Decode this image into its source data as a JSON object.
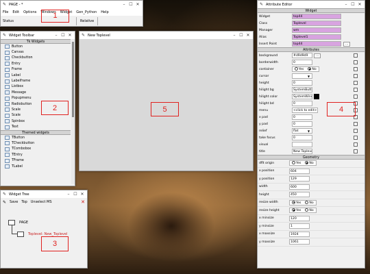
{
  "page_window": {
    "title": "PAGE - *",
    "menu": [
      "File",
      "Edit",
      "Options",
      "Windows",
      "Widget",
      "Gen_Python",
      "Help"
    ],
    "status_label": "Status",
    "relative_label": "Relative",
    "marker": "1"
  },
  "toolbar_window": {
    "title": "Widget Toolbar",
    "tk_section": "Tk Widgets",
    "tk_items": [
      "Button",
      "Canvas",
      "Checkbutton",
      "Entry",
      "Frame",
      "Label",
      "Labelframe",
      "Listbox",
      "Message",
      "Popupmenu",
      "Radiobutton",
      "Scale",
      "Scale",
      "Spinbox",
      "Text"
    ],
    "themed_section": "Themed widgets",
    "themed_items": [
      "TButton",
      "TCheckbutton",
      "TCombobox",
      "TEntry",
      "TFrame",
      "TLabel"
    ],
    "marker": "2"
  },
  "tree_window": {
    "title": "Widget Tree",
    "save_label": "Save",
    "top_label": "Top",
    "unselect_label": "Unselect MS",
    "root_node": "PAGE",
    "child_node": "Toplevel: New_Toplevel",
    "marker": "3"
  },
  "toplevel_window": {
    "title": "New Toplevel",
    "marker": "5"
  },
  "attr_window": {
    "title": "Attribute Editor",
    "widget_section": "Widget",
    "widget_rows": [
      {
        "label": "Widget",
        "value": "top44"
      },
      {
        "label": "Class",
        "value": "Toplevel"
      },
      {
        "label": "Manager",
        "value": "wm"
      },
      {
        "label": "Alias",
        "value": "Toplevel1"
      },
      {
        "label": "Insert Point",
        "value": "top44"
      }
    ],
    "attributes_section": "Attributes",
    "attr_rows": [
      {
        "label": "background",
        "value": "#d9d9d9"
      },
      {
        "label": "borderwidth",
        "value": "0"
      },
      {
        "label": "container",
        "value": "Yes / No"
      },
      {
        "label": "cursor",
        "value": ""
      },
      {
        "label": "height",
        "value": "0"
      },
      {
        "label": "hilight bg",
        "value": "SystemButto"
      },
      {
        "label": "hilight color",
        "value": "SystemWindo"
      },
      {
        "label": "hilight bd",
        "value": "0"
      },
      {
        "label": "menu",
        "value": "<click to edit>"
      },
      {
        "label": "x pad",
        "value": "0"
      },
      {
        "label": "y pad",
        "value": "0"
      },
      {
        "label": "relief",
        "value": "flat"
      },
      {
        "label": "take focus",
        "value": "0"
      },
      {
        "label": "visual",
        "value": ""
      },
      {
        "label": "title",
        "value": "New Toplevel"
      }
    ],
    "geometry_section": "Geometry",
    "geom_rows": [
      {
        "label": "dflt origin",
        "value": "radio"
      },
      {
        "label": "x position",
        "value": "604"
      },
      {
        "label": "y position",
        "value": "129"
      },
      {
        "label": "width",
        "value": "600"
      },
      {
        "label": "height",
        "value": "450"
      },
      {
        "label": "resize width",
        "value": "radio"
      },
      {
        "label": "resize height",
        "value": "radio"
      },
      {
        "label": "x minsize",
        "value": "120"
      },
      {
        "label": "y minsize",
        "value": "1"
      },
      {
        "label": "x maxsize",
        "value": "1924"
      },
      {
        "label": "y maxsize",
        "value": "1061"
      }
    ],
    "yes_label": "Yes",
    "no_label": "No",
    "marker": "4"
  }
}
